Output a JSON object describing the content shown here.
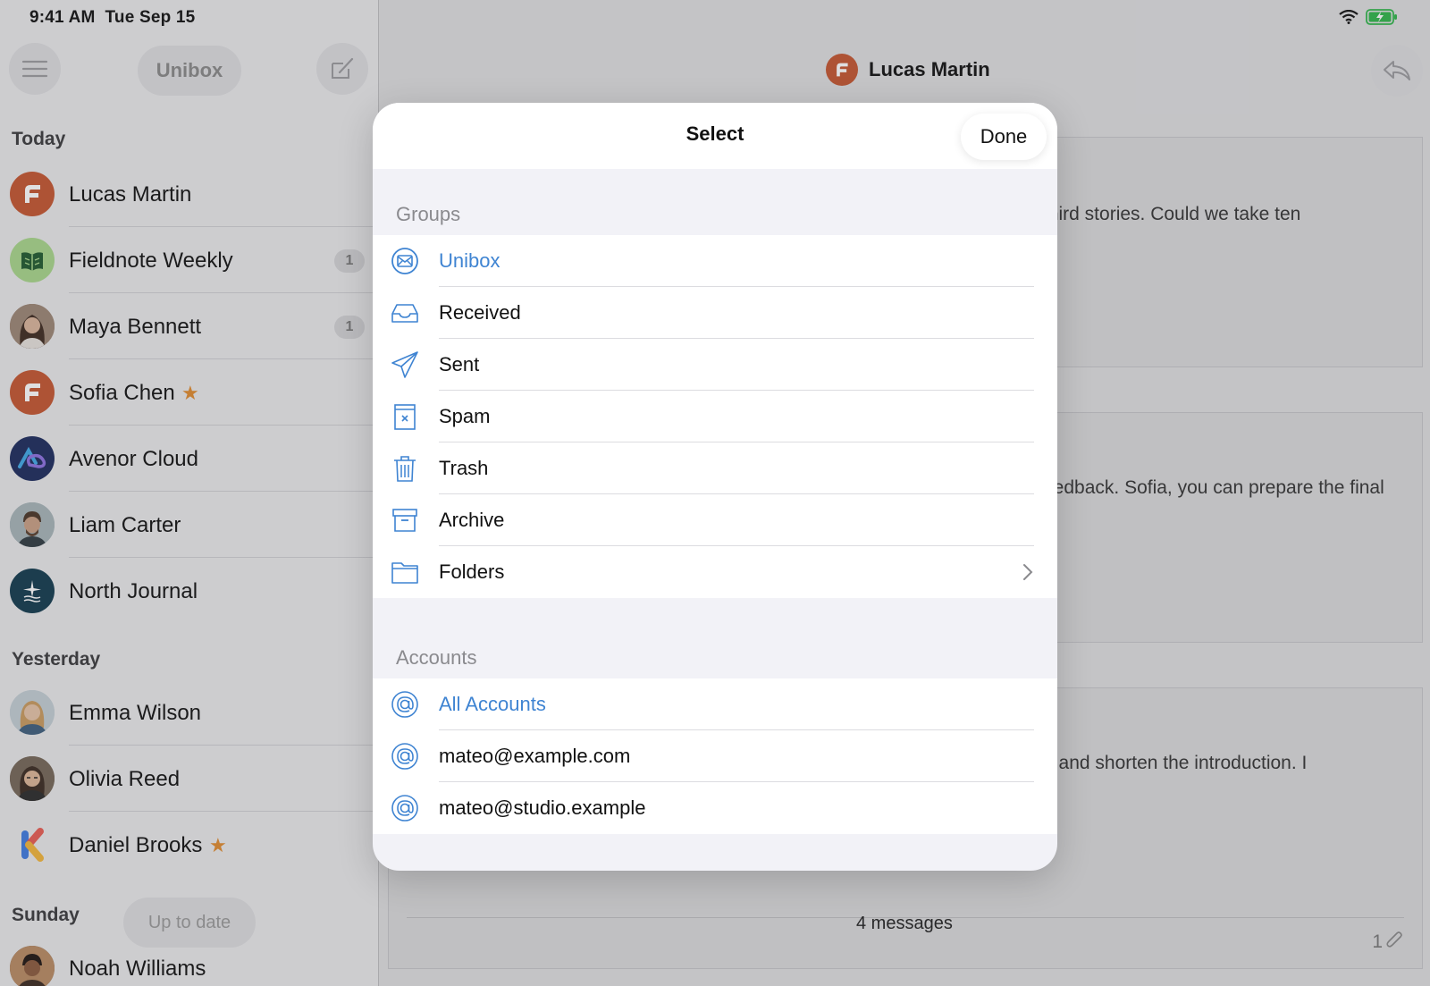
{
  "status_bar": {
    "time": "9:41 AM",
    "date": "Tue Sep 15"
  },
  "sidebar": {
    "title": "Unibox",
    "sections": [
      {
        "label": "Today",
        "items": [
          {
            "name": "Lucas Martin",
            "badge": null,
            "starred": false,
            "avatar": "f-logo"
          },
          {
            "name": "Fieldnote Weekly",
            "badge": "1",
            "starred": false,
            "avatar": "leaf-logo"
          },
          {
            "name": "Maya Bennett",
            "badge": "1",
            "starred": false,
            "avatar": "person"
          },
          {
            "name": "Sofia Chen",
            "badge": null,
            "starred": true,
            "avatar": "f-logo"
          },
          {
            "name": "Avenor Cloud",
            "badge": null,
            "starred": false,
            "avatar": "cloud-logo"
          },
          {
            "name": "Liam Carter",
            "badge": null,
            "starred": false,
            "avatar": "person"
          },
          {
            "name": "North Journal",
            "badge": null,
            "starred": false,
            "avatar": "star-logo"
          }
        ]
      },
      {
        "label": "Yesterday",
        "items": [
          {
            "name": "Emma Wilson",
            "badge": null,
            "starred": false,
            "avatar": "person"
          },
          {
            "name": "Olivia Reed",
            "badge": null,
            "starred": false,
            "avatar": "person"
          },
          {
            "name": "Daniel Brooks",
            "badge": null,
            "starred": true,
            "avatar": "k-logo"
          }
        ]
      },
      {
        "label": "Sunday",
        "items": [
          {
            "name": "Noah Williams",
            "badge": null,
            "starred": false,
            "avatar": "person"
          }
        ]
      }
    ],
    "up_to_date": "Up to date"
  },
  "detail": {
    "title": "Lucas Martin",
    "snippets": [
      "third stories. Could we take ten",
      "eedback. Sofia, you can prepare the final",
      "e and shorten the introduction. I"
    ],
    "message_count": "4 messages",
    "attachment_count": "1"
  },
  "modal": {
    "title": "Select",
    "done_label": "Done",
    "groups_label": "Groups",
    "groups": [
      {
        "label": "Unibox",
        "icon": "unibox-icon",
        "selected": true
      },
      {
        "label": "Received",
        "icon": "inbox-tray-icon",
        "selected": false
      },
      {
        "label": "Sent",
        "icon": "paper-plane-icon",
        "selected": false
      },
      {
        "label": "Spam",
        "icon": "spam-box-icon",
        "selected": false
      },
      {
        "label": "Trash",
        "icon": "trash-icon",
        "selected": false
      },
      {
        "label": "Archive",
        "icon": "archive-box-icon",
        "selected": false
      },
      {
        "label": "Folders",
        "icon": "folder-icon",
        "selected": false,
        "has_chevron": true
      }
    ],
    "accounts_label": "Accounts",
    "accounts": [
      {
        "label": "All Accounts",
        "icon": "at-sign-icon",
        "selected": true
      },
      {
        "label": "mateo@example.com",
        "icon": "at-sign-icon",
        "selected": false
      },
      {
        "label": "mateo@studio.example",
        "icon": "at-sign-icon",
        "selected": false
      }
    ]
  },
  "colors": {
    "accent": "#3f84d2",
    "star": "#e08a2e",
    "brand_orange": "#c4552f"
  }
}
